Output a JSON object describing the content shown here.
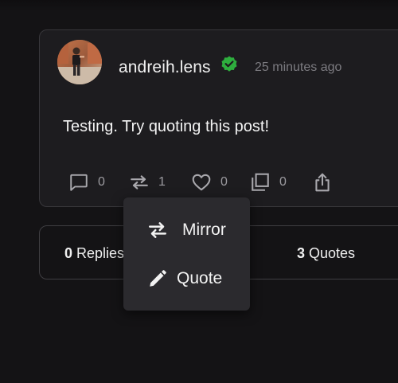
{
  "post": {
    "author": "andreih.lens",
    "timestamp": "25 minutes ago",
    "body": "Testing. Try quoting this post!",
    "actions": {
      "comments": "0",
      "mirrors": "1",
      "likes": "0",
      "collects": "0"
    }
  },
  "stats": {
    "replies_count": "0",
    "replies_label": "Replies",
    "quotes_count": "3",
    "quotes_label": "Quotes"
  },
  "menu": {
    "mirror_label": "Mirror",
    "quote_label": "Quote"
  },
  "colors": {
    "background": "#141315",
    "card": "#1d1c1f",
    "menu": "#2b2a2e",
    "verified": "#2eae3e",
    "muted_text": "#7c7b80"
  },
  "icons": {
    "comment": "comment-icon",
    "mirror": "mirror-icon",
    "like": "heart-icon",
    "collect": "collect-icon",
    "share": "share-icon",
    "verified": "verified-badge-icon",
    "quote": "pencil-icon"
  }
}
